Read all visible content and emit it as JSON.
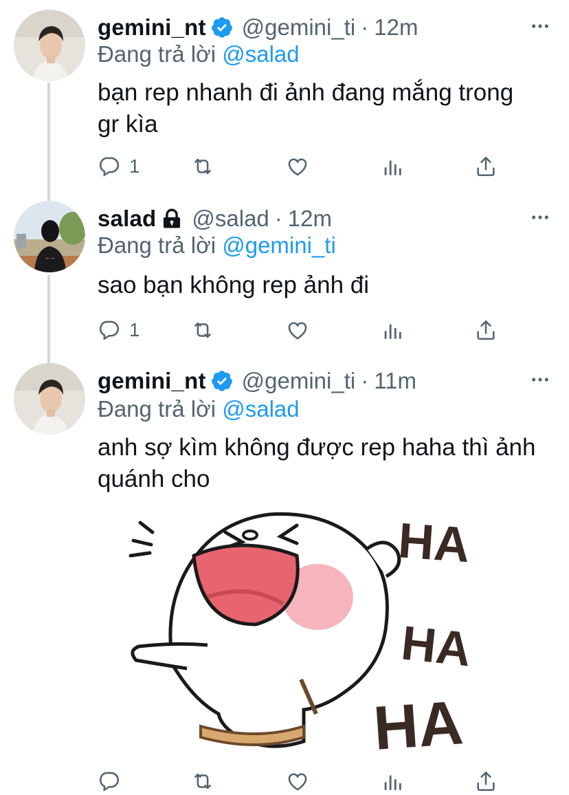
{
  "tweets": [
    {
      "display_name": "gemini_nt",
      "verified": true,
      "handle": "@gemini_ti",
      "separator": "·",
      "time": "12m",
      "replying_prefix": "Đang trả lời",
      "replying_to": "@salad",
      "text": "bạn rep nhanh đi ảnh đang mắng trong gr kìa",
      "reply_count": "1"
    },
    {
      "display_name": "salad",
      "protected": true,
      "handle": "@salad",
      "separator": "·",
      "time": "12m",
      "replying_prefix": "Đang trả lời",
      "replying_to": "@gemini_ti",
      "text": "sao bạn không rep ảnh đi",
      "reply_count": "1"
    },
    {
      "display_name": "gemini_nt",
      "verified": true,
      "handle": "@gemini_ti",
      "separator": "·",
      "time": "11m",
      "replying_prefix": "Đang trả lời",
      "replying_to": "@salad",
      "text": "anh sợ kìm không được rep haha thì ảnh quánh cho",
      "reply_count": "",
      "media": {
        "stickers": [
          "HA",
          "HA",
          "HA"
        ]
      }
    }
  ],
  "colors": {
    "accent": "#1d9bf0",
    "secondary": "#536471",
    "ha_brown": "#3b2a24",
    "cheek": "#f4a8b2",
    "mouth": "#e8646f"
  },
  "icons": [
    "verified-badge-icon",
    "lock-icon",
    "more-icon",
    "reply-icon",
    "retweet-icon",
    "like-icon",
    "analytics-icon",
    "share-icon"
  ]
}
